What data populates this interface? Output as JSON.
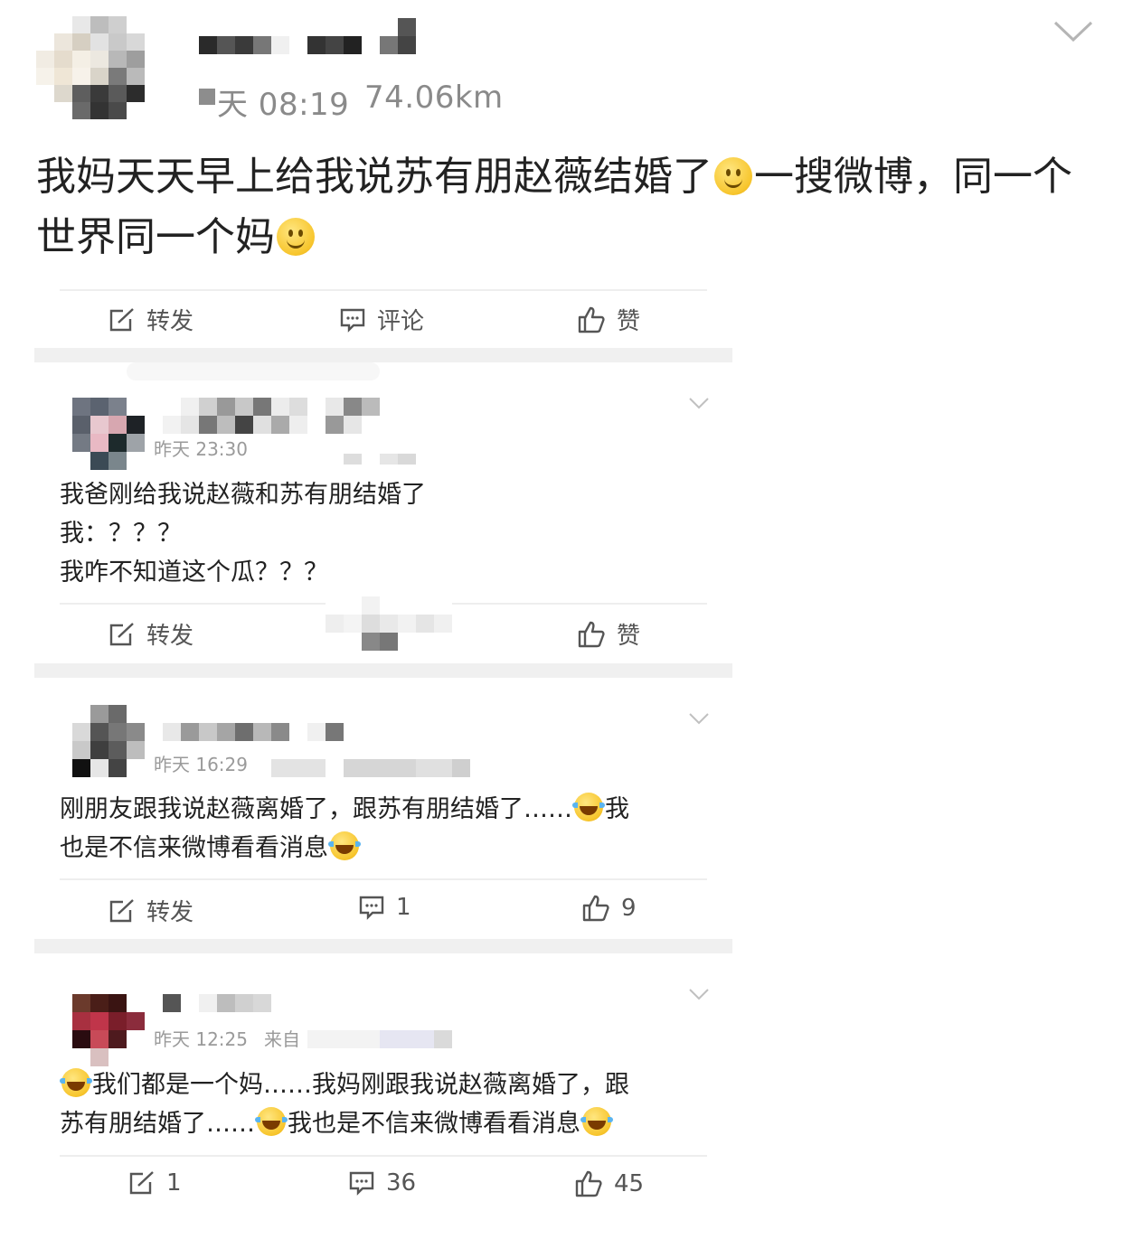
{
  "post": {
    "time": "天 08:19",
    "distance": "74.06km",
    "text_part1": "我妈天天早上给我说苏有朋赵薇结婚了",
    "text_part2": "一搜微博，同一个世界同一个妈",
    "emoji": "smile-emoji",
    "actions": {
      "repost": "转发",
      "comment": "评论",
      "like": "赞"
    }
  },
  "comments": [
    {
      "time": "昨天 23:30",
      "lines": [
        "我爸刚给我说赵薇和苏有朋结婚了",
        "我：？？？",
        "我咋不知道这个瓜？？？"
      ],
      "actions": {
        "repost": "转发",
        "like": "赞"
      }
    },
    {
      "time": "昨天 16:29",
      "line1": "刚朋友跟我说赵薇离婚了，跟苏有朋结婚了……",
      "line1_tail": "我",
      "line2": "也是不信来微博看看消息",
      "actions": {
        "repost": "转发",
        "comment_count": "1",
        "like_count": "9"
      }
    },
    {
      "time": "昨天 12:25",
      "source_prefix": "来自",
      "line1": "我们都是一个妈……我妈刚跟我说赵薇离婚了，跟",
      "line2a": "苏有朋结婚了……",
      "line2b": "我也是不信来微博看看消息",
      "actions": {
        "repost_count": "1",
        "comment_count": "36",
        "like_count": "45"
      }
    }
  ],
  "colors": {
    "text": "#222222",
    "muted": "#8a8a8a",
    "divider": "#eeeeee",
    "band": "#f0f0f0"
  },
  "icons": [
    "chevron-down-icon",
    "repost-icon",
    "comment-icon",
    "like-icon",
    "laugh-cry-emoji",
    "smile-emoji"
  ]
}
